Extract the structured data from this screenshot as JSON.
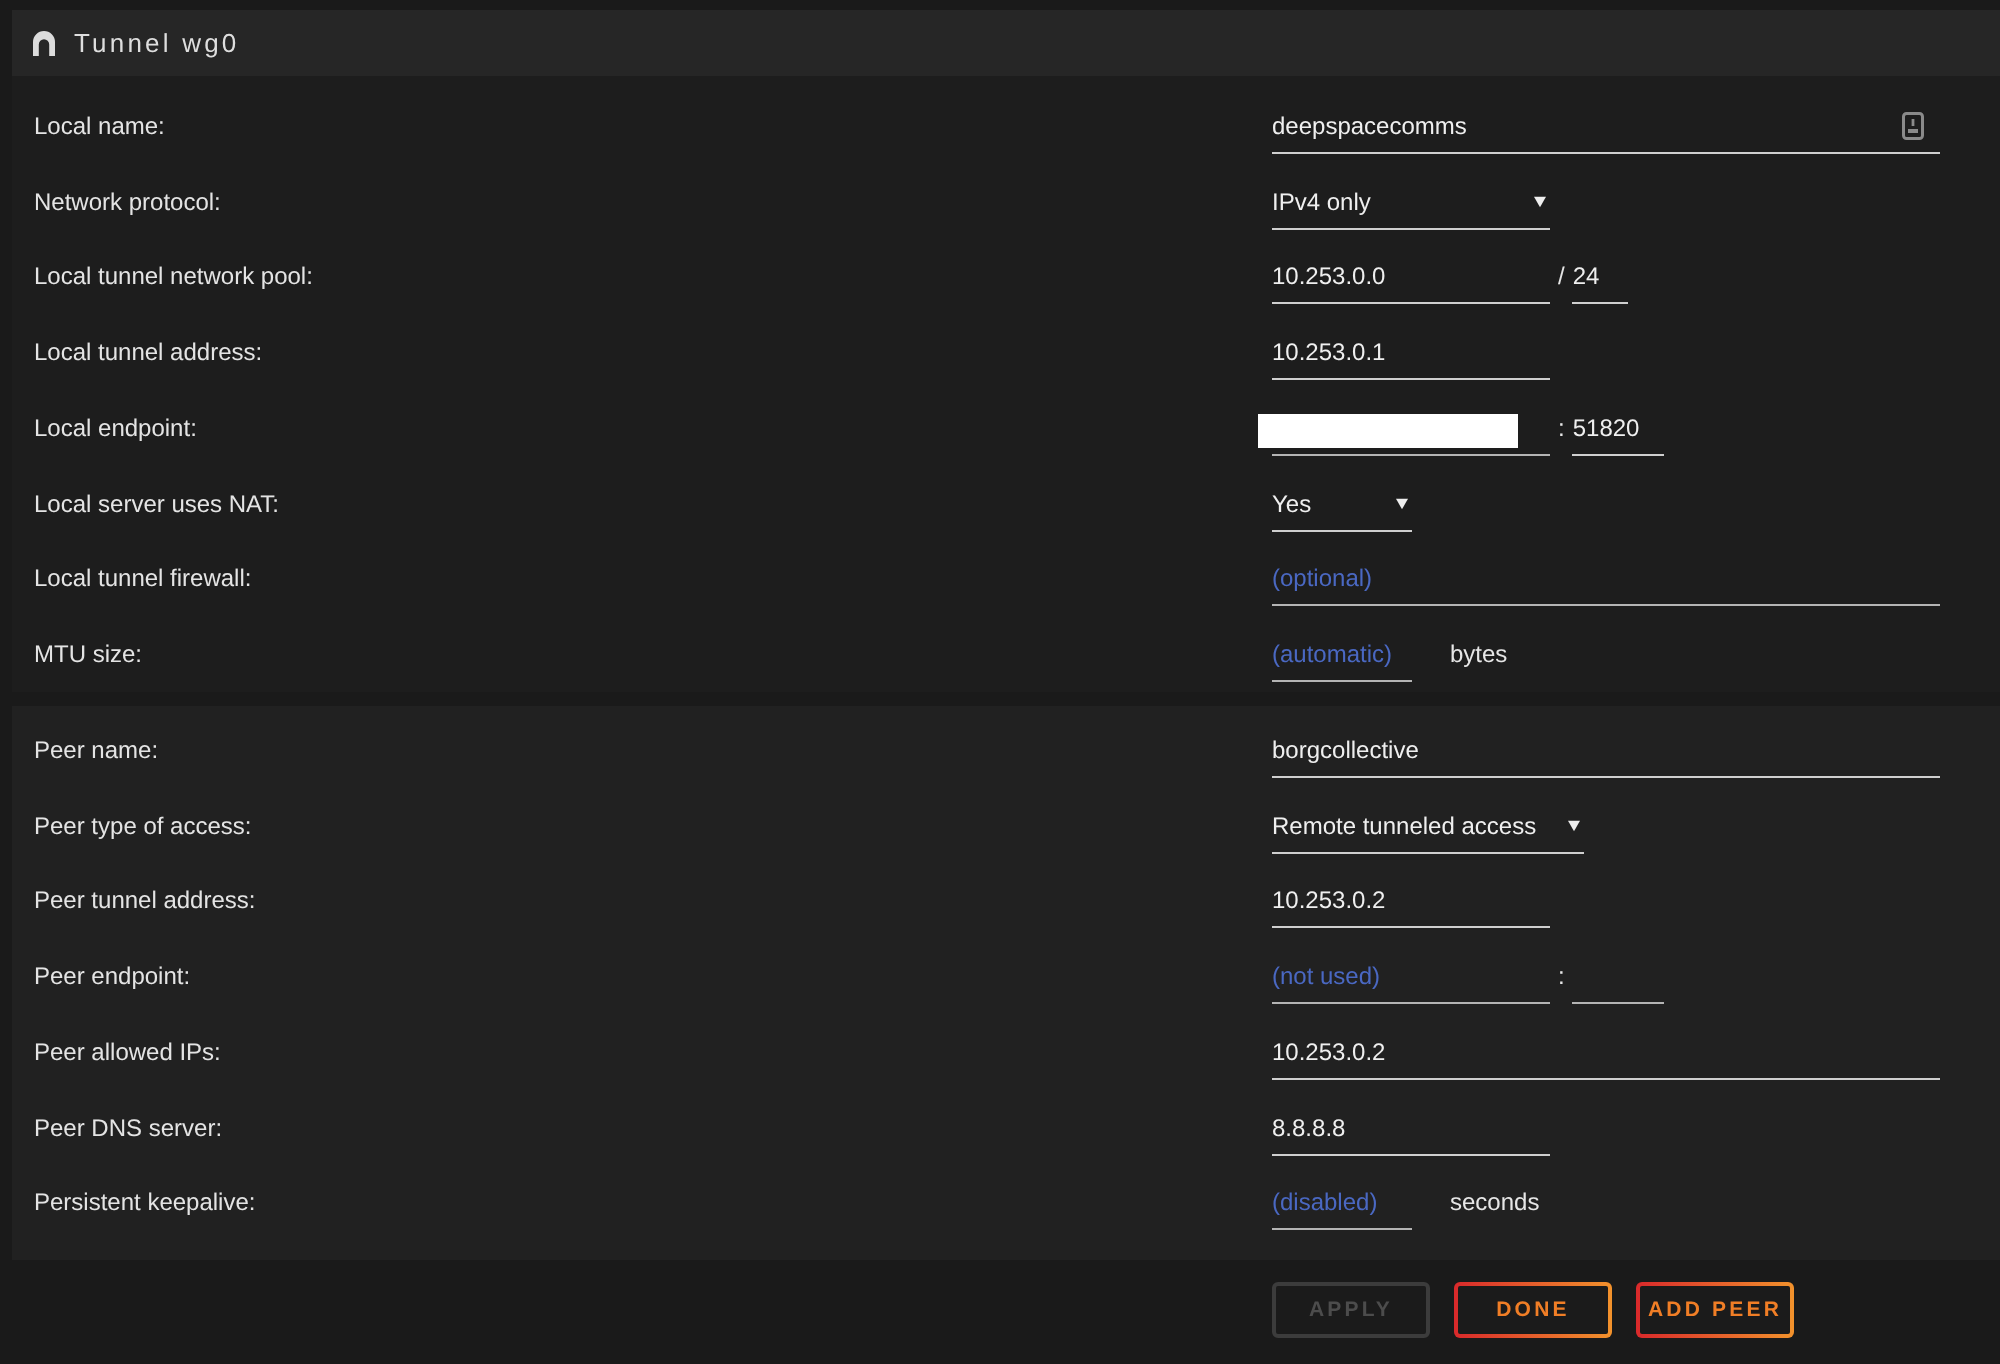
{
  "header": {
    "title": "Tunnel wg0"
  },
  "sections": [
    {
      "rows": [
        {
          "label": "Local name:",
          "kind": "wide",
          "value": "deepspacecomms",
          "trailing_icon": true
        },
        {
          "label": "Network protocol:",
          "kind": "select",
          "value": "IPv4 only"
        },
        {
          "label": "Local tunnel network pool:",
          "kind": "prefix",
          "fields": [
            {
              "value": "10.253.0.0"
            },
            {
              "value": "24"
            }
          ],
          "separator": "/"
        },
        {
          "label": "Local tunnel address:",
          "kind": "text",
          "value": "10.253.0.1"
        },
        {
          "label": "Local endpoint:",
          "kind": "endpoint",
          "fields": [
            {
              "redacted": true
            },
            {
              "value": "51820"
            }
          ],
          "separator": ":"
        },
        {
          "label": "Local server uses NAT:",
          "kind": "compact",
          "value": "Yes"
        },
        {
          "label": "Local tunnel firewall:",
          "kind": "wide",
          "placeholder": "(optional)"
        },
        {
          "label": "MTU size:",
          "kind": "unit",
          "placeholder": "(automatic)",
          "unit": "bytes"
        }
      ]
    },
    {
      "rows": [
        {
          "label": "Peer name:",
          "kind": "wide",
          "value": "borgcollective"
        },
        {
          "label": "Peer type of access:",
          "kind": "select",
          "value": "Remote tunneled access"
        },
        {
          "label": "Peer tunnel address:",
          "kind": "text",
          "value": "10.253.0.2"
        },
        {
          "label": "Peer endpoint:",
          "kind": "endpoint",
          "fields": [
            {
              "placeholder": "(not used)"
            }
          ],
          "separator": ":"
        },
        {
          "label": "Peer allowed IPs:",
          "kind": "wide",
          "value": "10.253.0.2"
        },
        {
          "label": "Peer DNS server:",
          "kind": "text",
          "value": "8.8.8.8"
        },
        {
          "label": "Persistent keepalive:",
          "kind": "unit",
          "placeholder": "(disabled)",
          "unit": "seconds"
        }
      ]
    }
  ],
  "buttons": [
    {
      "label": "APPLY",
      "disabled": true
    },
    {
      "label": "DONE",
      "disabled": false
    },
    {
      "label": "ADD PEER",
      "disabled": false
    }
  ]
}
